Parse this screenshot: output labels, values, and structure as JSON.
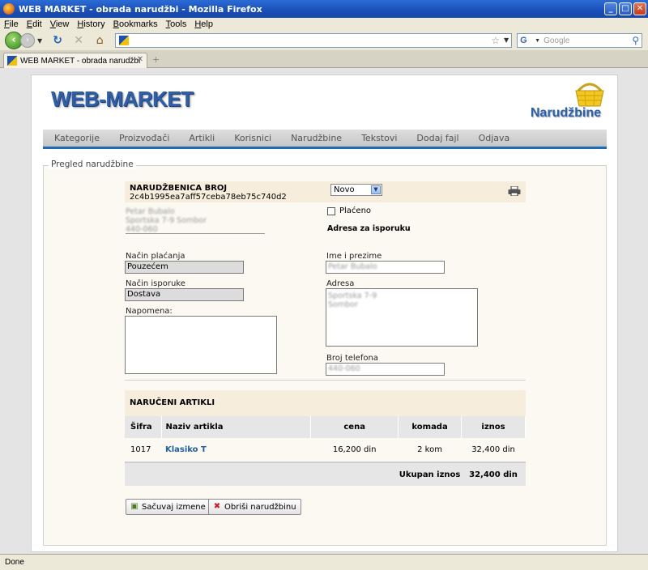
{
  "window": {
    "title": "WEB MARKET - obrada narudžbi - Mozilla Firefox"
  },
  "menu": [
    "File",
    "Edit",
    "View",
    "History",
    "Bookmarks",
    "Tools",
    "Help"
  ],
  "toolbar": {
    "url": "",
    "search_placeholder": "Google"
  },
  "tab": {
    "title": "WEB MARKET - obrada narudžbi"
  },
  "status_bar": {
    "text": "Done"
  },
  "site": {
    "logo": "WEB-MARKET",
    "section_title": "Narudžbine"
  },
  "nav": [
    "Kategorije",
    "Proizvođači",
    "Artikli",
    "Korisnici",
    "Narudžbine",
    "Tekstovi",
    "Dodaj fajl",
    "Odjava"
  ],
  "order": {
    "legend": "Pregled narudžbine",
    "number_label": "NARUDŽBENICA BROJ",
    "number": "2c4b1995ea7aff57ceba78eb75c740d2",
    "status": "Novo",
    "paid_label": "Plaćeno",
    "paid": false,
    "customer_lines": [
      "Petar Bubalo",
      "Sportska 7-9 Sombor",
      "440-060"
    ],
    "ship_to_label": "Adresa za isporuku",
    "payment": {
      "label": "Način plaćanja",
      "value": "Pouzećem"
    },
    "delivery": {
      "label": "Način isporuke",
      "value": "Dostava"
    },
    "note": {
      "label": "Napomena:",
      "value": ""
    },
    "name": {
      "label": "Ime i prezime",
      "value": "Petar Bubalo"
    },
    "address": {
      "label": "Adresa",
      "lines": [
        "Sportska 7-9",
        "Sombor"
      ]
    },
    "phone": {
      "label": "Broj telefona",
      "value": "440-060"
    }
  },
  "items": {
    "title": "NARUČENI ARTIKLI",
    "headers": [
      "Šifra",
      "Naziv artikla",
      "cena",
      "komada",
      "iznos"
    ],
    "rows": [
      {
        "code": "1017",
        "name": "Klasiko T",
        "price": "16,200 din",
        "qty": "2 kom",
        "amount": "32,400 din"
      }
    ],
    "total_label": "Ukupan iznos",
    "total": "32,400 din"
  },
  "buttons": {
    "save": "Sačuvaj izmene",
    "delete": "Obriši narudžbinu"
  },
  "colors": {
    "brand_blue": "#2f5fa8",
    "nav_underline": "#1f6bb3",
    "header_bg": "#f6eddc",
    "link": "#1f5fa3"
  }
}
